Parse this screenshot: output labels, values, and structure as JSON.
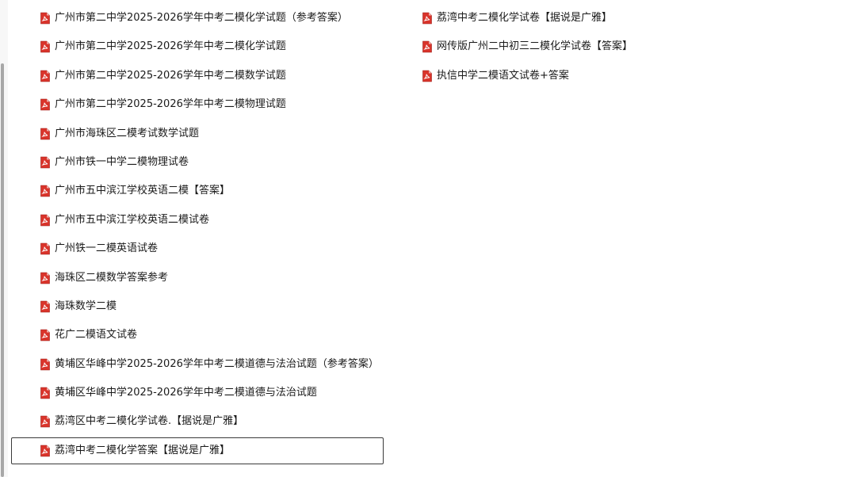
{
  "colors": {
    "pdf_red": "#d9342b",
    "border": "#3a3a3a",
    "scrollbar": "#a8a8a8"
  },
  "icon": "pdf-file-icon",
  "files_left": [
    {
      "name": "广州市第二中学2025-2026学年中考二模化学试题（参考答案）"
    },
    {
      "name": "广州市第二中学2025-2026学年中考二模化学试题"
    },
    {
      "name": "广州市第二中学2025-2026学年中考二模数学试题"
    },
    {
      "name": "广州市第二中学2025-2026学年中考二模物理试题"
    },
    {
      "name": "广州市海珠区二模考试数学试题"
    },
    {
      "name": "广州市铁一中学二模物理试卷"
    },
    {
      "name": "广州市五中滨江学校英语二模【答案】"
    },
    {
      "name": "广州市五中滨江学校英语二模试卷"
    },
    {
      "name": "广州铁一二模英语试卷"
    },
    {
      "name": "海珠区二模数学答案参考"
    },
    {
      "name": "海珠数学二模"
    },
    {
      "name": "花广二模语文试卷"
    },
    {
      "name": "黄埔区华峰中学2025-2026学年中考二模道德与法治试题（参考答案）"
    },
    {
      "name": "黄埔区华峰中学2025-2026学年中考二模道德与法治试题"
    },
    {
      "name": "荔湾区中考二模化学试卷.【据说是广雅】"
    },
    {
      "name": "荔湾中考二模化学答案【据说是广雅】"
    }
  ],
  "files_right": [
    {
      "name": "荔湾中考二模化学试卷【据说是广雅】"
    },
    {
      "name": "网传版广州二中初三二模化学试卷【答案】"
    },
    {
      "name": "执信中学二模语文试卷+答案"
    }
  ]
}
